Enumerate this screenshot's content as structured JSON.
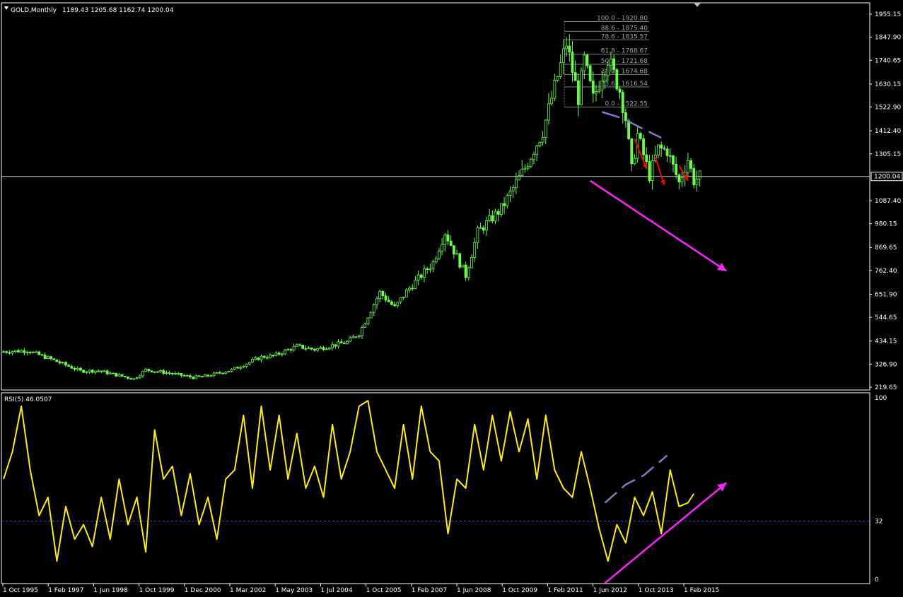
{
  "colors": {
    "background": "#000000",
    "frame": "#ffffff",
    "candle": "#66ff44",
    "price_line": "#c8c8c8",
    "rsi_line": "#ffee00",
    "rsi_level": "#3b3bd6",
    "trend_arrow": "#ff22ff",
    "divergence_dash": "#7d7dcc",
    "red_arrow": "#ff0000",
    "fib": "#7f7f7f"
  },
  "chart_data": [
    {
      "type": "candlestick",
      "title": "GOLD,Monthly",
      "ohlc_label": "1189.43 1205.68 1162.74 1200.04",
      "current_price": 1200.04,
      "current_price_label": "1200.04",
      "ylim": [
        219.65,
        1955.15
      ],
      "y_ticks": [
        "1955.15",
        "1847.90",
        "1740.65",
        "1630.15",
        "1522.90",
        "1412.40",
        "1305.15",
        "1087.40",
        "980.15",
        "869.65",
        "762.40",
        "651.90",
        "544.65",
        "434.15",
        "326.90",
        "219.65"
      ],
      "x_ticks": [
        "1 Oct 1995",
        "1 Feb 1997",
        "1 Jun 1998",
        "1 Oct 1999",
        "1 Dec 2000",
        "1 Mar 2002",
        "1 May 2003",
        "1 Jul 2004",
        "1 Oct 2005",
        "1 Feb 2007",
        "1 Jun 2008",
        "1 Oct 2009",
        "1 Feb 2011",
        "1 Jun 2012",
        "1 Oct 2013",
        "1 Feb 2015"
      ],
      "trend_points": [
        [
          "1995-10",
          385
        ],
        [
          "1996-06",
          390
        ],
        [
          "1997-02",
          350
        ],
        [
          "1997-12",
          295
        ],
        [
          "1998-06",
          296
        ],
        [
          "1999-06",
          258
        ],
        [
          "1999-10",
          300
        ],
        [
          "2000-06",
          285
        ],
        [
          "2001-02",
          265
        ],
        [
          "2001-06",
          270
        ],
        [
          "2002-03",
          300
        ],
        [
          "2003-01",
          360
        ],
        [
          "2003-05",
          365
        ],
        [
          "2004-01",
          410
        ],
        [
          "2004-07",
          395
        ],
        [
          "2005-06",
          430
        ],
        [
          "2005-10",
          470
        ],
        [
          "2006-05",
          660
        ],
        [
          "2006-10",
          590
        ],
        [
          "2007-02",
          665
        ],
        [
          "2007-11",
          800
        ],
        [
          "2008-03",
          940
        ],
        [
          "2008-10",
          740
        ],
        [
          "2009-02",
          940
        ],
        [
          "2009-10",
          1050
        ],
        [
          "2010-06",
          1240
        ],
        [
          "2010-12",
          1410
        ],
        [
          "2011-08",
          1820
        ],
        [
          "2011-12",
          1565
        ],
        [
          "2012-02",
          1740
        ],
        [
          "2012-05",
          1560
        ],
        [
          "2012-10",
          1750
        ],
        [
          "2013-02",
          1600
        ],
        [
          "2013-04",
          1470
        ],
        [
          "2013-06",
          1230
        ],
        [
          "2013-08",
          1395
        ],
        [
          "2013-12",
          1205
        ],
        [
          "2014-03",
          1330
        ],
        [
          "2014-06",
          1320
        ],
        [
          "2014-10",
          1170
        ],
        [
          "2015-01",
          1280
        ],
        [
          "2015-03",
          1180
        ],
        [
          "2015-05",
          1200
        ]
      ],
      "fibonacci": [
        {
          "label": "100.0 - 1920.80",
          "value": 1920.8
        },
        {
          "label": "88.6 - 1875.40",
          "value": 1875.4
        },
        {
          "label": "78.6 - 1835.57",
          "value": 1835.57
        },
        {
          "label": "61.8 - 1768.67",
          "value": 1768.67
        },
        {
          "label": "50.0 - 1721.68",
          "value": 1721.68
        },
        {
          "label": "38.2 - 1674.68",
          "value": 1674.68
        },
        {
          "label": "23.6 - 1616.54",
          "value": 1616.54
        },
        {
          "label": "0.0 - 1522.55",
          "value": 1522.55
        }
      ],
      "annotations": {
        "downtrend_arrow": {
          "from": [
            "2012-04",
            1180
          ],
          "to": [
            "2016-02",
            760
          ]
        },
        "divergence_dash": [
          [
            "2012-08",
            1500
          ],
          [
            "2013-03",
            1470
          ],
          [
            "2013-10",
            1420
          ],
          [
            "2014-04",
            1380
          ]
        ],
        "red_arrows": [
          {
            "from": [
              "2013-07",
              1375
            ],
            "to": [
              "2013-11",
              1235
            ]
          },
          {
            "from": [
              "2014-02",
              1290
            ],
            "to": [
              "2014-05",
              1160
            ]
          },
          {
            "from": [
              "2014-10",
              1250
            ],
            "to": [
              "2015-01",
              1180
            ]
          }
        ]
      }
    },
    {
      "type": "line",
      "title": "RSI(5) 46.0507",
      "ylim": [
        0,
        100
      ],
      "y_ticks": [
        "100",
        "32",
        "0"
      ],
      "level": 32,
      "points": [
        [
          "1995-10",
          55
        ],
        [
          "1996-01",
          70
        ],
        [
          "1996-04",
          95
        ],
        [
          "1996-07",
          60
        ],
        [
          "1996-10",
          35
        ],
        [
          "1997-01",
          45
        ],
        [
          "1997-04",
          10
        ],
        [
          "1997-07",
          40
        ],
        [
          "1997-10",
          22
        ],
        [
          "1998-01",
          30
        ],
        [
          "1998-04",
          18
        ],
        [
          "1998-07",
          45
        ],
        [
          "1998-10",
          22
        ],
        [
          "1999-01",
          55
        ],
        [
          "1999-04",
          30
        ],
        [
          "1999-07",
          45
        ],
        [
          "1999-10",
          15
        ],
        [
          "2000-01",
          82
        ],
        [
          "2000-04",
          55
        ],
        [
          "2000-07",
          62
        ],
        [
          "2000-10",
          35
        ],
        [
          "2001-01",
          58
        ],
        [
          "2001-04",
          30
        ],
        [
          "2001-07",
          45
        ],
        [
          "2001-10",
          22
        ],
        [
          "2002-01",
          55
        ],
        [
          "2002-04",
          60
        ],
        [
          "2002-07",
          90
        ],
        [
          "2002-10",
          50
        ],
        [
          "2003-01",
          95
        ],
        [
          "2003-04",
          60
        ],
        [
          "2003-07",
          90
        ],
        [
          "2003-10",
          55
        ],
        [
          "2004-01",
          80
        ],
        [
          "2004-04",
          50
        ],
        [
          "2004-07",
          62
        ],
        [
          "2004-10",
          45
        ],
        [
          "2005-01",
          85
        ],
        [
          "2005-04",
          55
        ],
        [
          "2005-07",
          70
        ],
        [
          "2005-10",
          95
        ],
        [
          "2006-01",
          98
        ],
        [
          "2006-04",
          70
        ],
        [
          "2006-07",
          60
        ],
        [
          "2006-10",
          50
        ],
        [
          "2007-01",
          85
        ],
        [
          "2007-04",
          55
        ],
        [
          "2007-07",
          95
        ],
        [
          "2007-10",
          70
        ],
        [
          "2008-01",
          65
        ],
        [
          "2008-04",
          25
        ],
        [
          "2008-07",
          55
        ],
        [
          "2008-10",
          50
        ],
        [
          "2009-01",
          85
        ],
        [
          "2009-04",
          60
        ],
        [
          "2009-07",
          90
        ],
        [
          "2009-10",
          65
        ],
        [
          "2010-01",
          92
        ],
        [
          "2010-04",
          70
        ],
        [
          "2010-07",
          88
        ],
        [
          "2010-10",
          55
        ],
        [
          "2011-01",
          90
        ],
        [
          "2011-04",
          60
        ],
        [
          "2011-07",
          50
        ],
        [
          "2011-10",
          45
        ],
        [
          "2012-01",
          70
        ],
        [
          "2012-04",
          50
        ],
        [
          "2012-07",
          28
        ],
        [
          "2012-10",
          10
        ],
        [
          "2013-01",
          30
        ],
        [
          "2013-04",
          20
        ],
        [
          "2013-07",
          45
        ],
        [
          "2013-10",
          35
        ],
        [
          "2014-01",
          48
        ],
        [
          "2014-04",
          25
        ],
        [
          "2014-07",
          60
        ],
        [
          "2014-10",
          40
        ],
        [
          "2015-01",
          42
        ],
        [
          "2015-03",
          47
        ]
      ],
      "annotations": {
        "uptrend_arrow": {
          "from": [
            "2012-09",
            -2
          ],
          "to": [
            "2016-02",
            53
          ]
        },
        "divergence_dash": [
          [
            "2012-09",
            42
          ],
          [
            "2013-04",
            52
          ],
          [
            "2013-10",
            57
          ],
          [
            "2014-06",
            68
          ]
        ]
      }
    }
  ]
}
